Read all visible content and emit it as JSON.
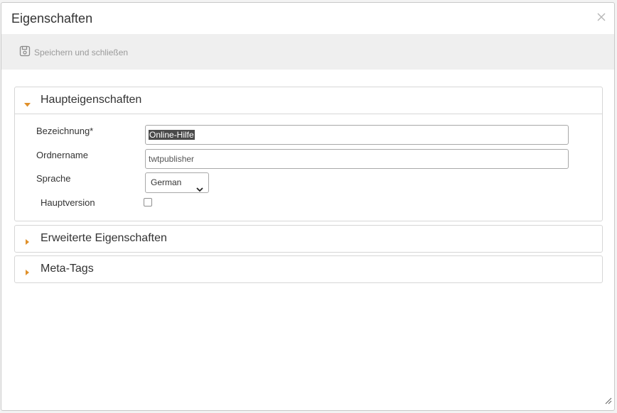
{
  "dialog": {
    "title": "Eigenschaften",
    "close_icon": "close-icon"
  },
  "toolbar": {
    "save_close_label": "Speichern und schließen",
    "save_icon": "floppy-disk-icon"
  },
  "panels": {
    "main": {
      "title": "Haupteigenschaften",
      "expanded": true,
      "fields": {
        "bezeichnung": {
          "label": "Bezeichnung*",
          "value": "Online-Hilfe"
        },
        "ordnername": {
          "label": "Ordnername",
          "value": "twtpublisher"
        },
        "sprache": {
          "label": "Sprache",
          "value": "German"
        },
        "hauptversion": {
          "label": "Hauptversion",
          "checked": false
        }
      }
    },
    "extended": {
      "title": "Erweiterte Eigenschaften",
      "expanded": false
    },
    "meta": {
      "title": "Meta-Tags",
      "expanded": false
    }
  },
  "colors": {
    "accent_arrow": "#e0902a",
    "toolbar_bg": "#efefef"
  }
}
